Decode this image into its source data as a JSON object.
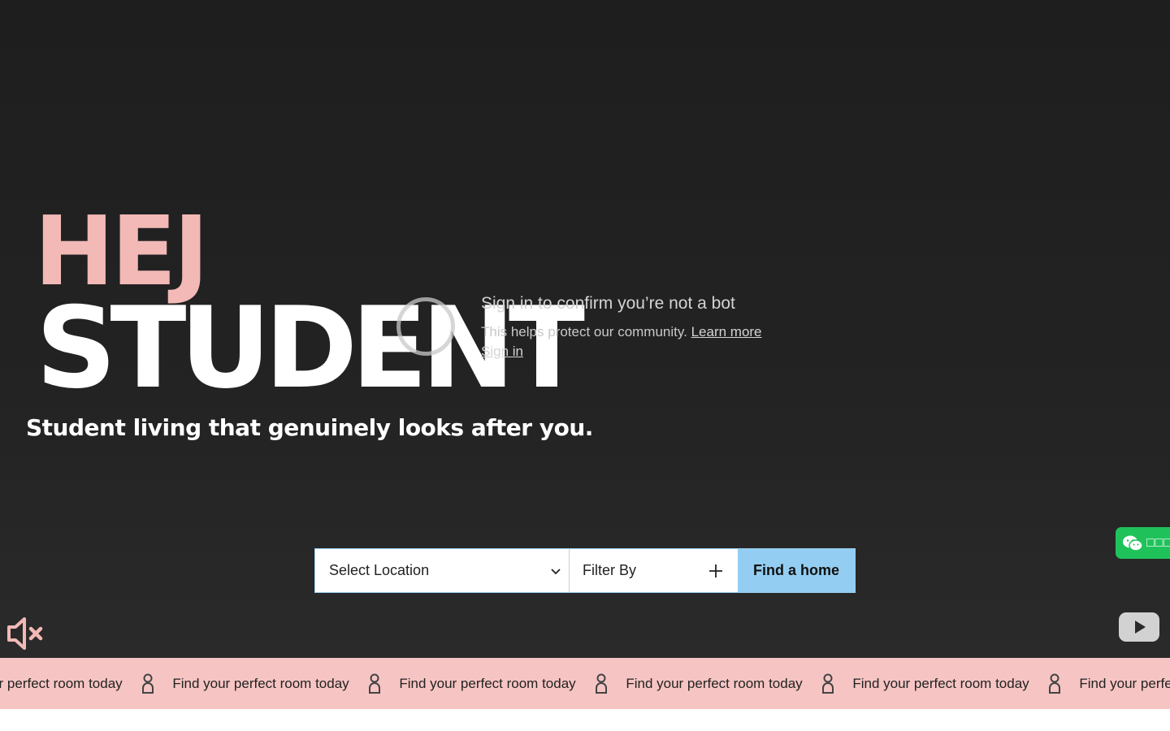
{
  "hero": {
    "logo_line1": "HEJ",
    "logo_line2": "STUDENT",
    "tagline": "Student living that genuinely looks after you."
  },
  "video_overlay": {
    "title": "Sign in to confirm you’re not a bot",
    "description": "This helps protect our community.",
    "learn_more": "Learn more",
    "sign_in": "Sign in"
  },
  "search": {
    "location_label": "Select Location",
    "filter_label": "Filter By",
    "submit_label": "Find a home"
  },
  "wechat": {
    "label": "□□□"
  },
  "marquee": {
    "items": [
      "Find your perfect room today",
      "Find your perfect room today",
      "Find your perfect room today",
      "Find your perfect room today",
      "Find your perfect room today",
      "Find your perfect room today"
    ]
  },
  "colors": {
    "hero_bg": "#232323",
    "logo_pink": "#f2b9b6",
    "marquee_bg": "#f6c5c3",
    "cta_blue": "#93cdf1",
    "wechat_green": "#1fc25a"
  },
  "icons": {
    "mute": "speaker-muted-icon",
    "youtube": "youtube-icon",
    "dropdown": "chevron-down-icon",
    "filter": "plus-icon",
    "marquee_separator": "person-icon",
    "wechat": "wechat-icon"
  }
}
